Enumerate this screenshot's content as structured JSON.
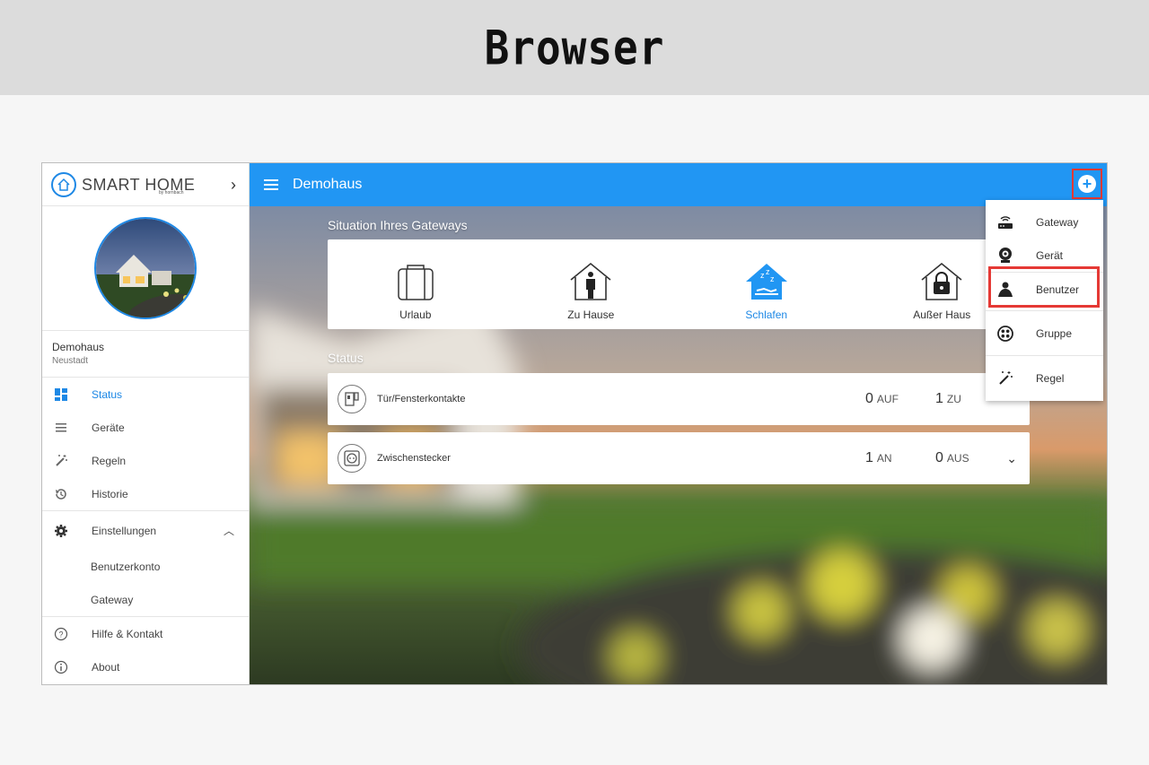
{
  "banner": {
    "title": "Browser"
  },
  "brand": {
    "name": "SMART HOME",
    "sub": "by hornbach"
  },
  "home": {
    "name": "Demohaus",
    "location": "Neustadt"
  },
  "nav": {
    "status": "Status",
    "devices": "Geräte",
    "rules": "Regeln",
    "history": "Historie",
    "settings": "Einstellungen",
    "account": "Benutzerkonto",
    "gateway": "Gateway",
    "help": "Hilfe & Kontakt",
    "about": "About"
  },
  "topbar": {
    "title": "Demohaus"
  },
  "situation": {
    "title": "Situation Ihres Gateways",
    "scenes": [
      "Urlaub",
      "Zu Hause",
      "Schlafen",
      "Außer Haus"
    ],
    "active": "Schlafen"
  },
  "status": {
    "title": "Status",
    "rows": [
      {
        "label": "Tür/Fensterkontakte",
        "a_val": "0",
        "a_unit": "AUF",
        "b_val": "1",
        "b_unit": "ZU"
      },
      {
        "label": "Zwischenstecker",
        "a_val": "1",
        "a_unit": "AN",
        "b_val": "0",
        "b_unit": "AUS"
      }
    ]
  },
  "menu": {
    "items": [
      "Gateway",
      "Gerät",
      "Benutzer",
      "Gruppe",
      "Regel"
    ],
    "highlighted": "Benutzer"
  },
  "colors": {
    "accent": "#2196f3",
    "highlight": "#e53935"
  }
}
